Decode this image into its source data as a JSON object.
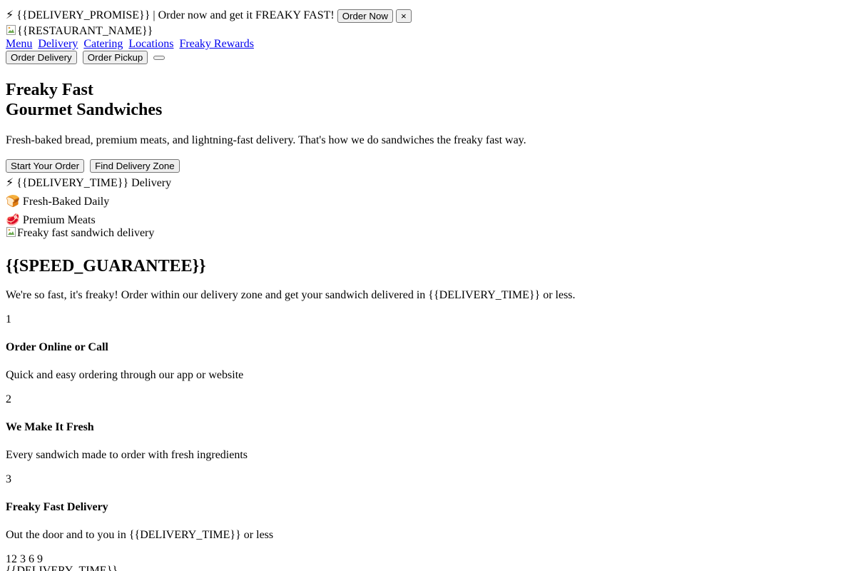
{
  "promo_bar": {
    "icon": "lightning-icon",
    "icon_glyph": "⚡",
    "text": "{{DELIVERY_PROMISE}} | Order now and get it FREAKY FAST!",
    "order_now_label": "Order Now",
    "close_label": "×"
  },
  "header": {
    "logo_alt": "{{RESTAURANT_NAME}}",
    "nav": [
      {
        "label": "Menu"
      },
      {
        "label": "Delivery"
      },
      {
        "label": "Catering"
      },
      {
        "label": "Locations"
      },
      {
        "label": "Freaky Rewards"
      }
    ],
    "order_delivery_label": "Order Delivery",
    "order_pickup_label": "Order Pickup"
  },
  "hero": {
    "title_line1": "Freaky Fast",
    "title_line2": "Gourmet Sandwiches",
    "subtitle": "Fresh-baked bread, premium meats, and lightning-fast delivery. That's how we do sandwiches the freaky fast way.",
    "start_order_label": "Start Your Order",
    "find_zone_label": "Find Delivery Zone",
    "features": [
      {
        "icon": "lightning-icon",
        "glyph": "⚡",
        "text": "{{DELIVERY_TIME}} Delivery"
      },
      {
        "icon": "bread-icon",
        "glyph": "🍞",
        "text": "Fresh-Baked Daily"
      },
      {
        "icon": "meat-icon",
        "glyph": "🥩",
        "text": "Premium Meats"
      }
    ],
    "image_alt": "Freaky fast sandwich delivery"
  },
  "guarantee": {
    "title": "{{SPEED_GUARANTEE}}",
    "text": "We're so fast, it's freaky! Order within our delivery zone and get your sandwich delivered in {{DELIVERY_TIME}} or less.",
    "steps": [
      {
        "number": "1",
        "title": "Order Online or Call",
        "desc": "Quick and easy ordering through our app or website"
      },
      {
        "number": "2",
        "title": "We Make It Fresh",
        "desc": "Every sandwich made to order with fresh ingredients"
      },
      {
        "number": "3",
        "title": "Freaky Fast Delivery",
        "desc": "Out the door and to you in {{DELIVERY_TIME}} or less"
      }
    ],
    "clock_numbers": [
      "12",
      "3",
      "6",
      "9"
    ],
    "clock_label": "{{DELIVERY_TIME}}"
  }
}
